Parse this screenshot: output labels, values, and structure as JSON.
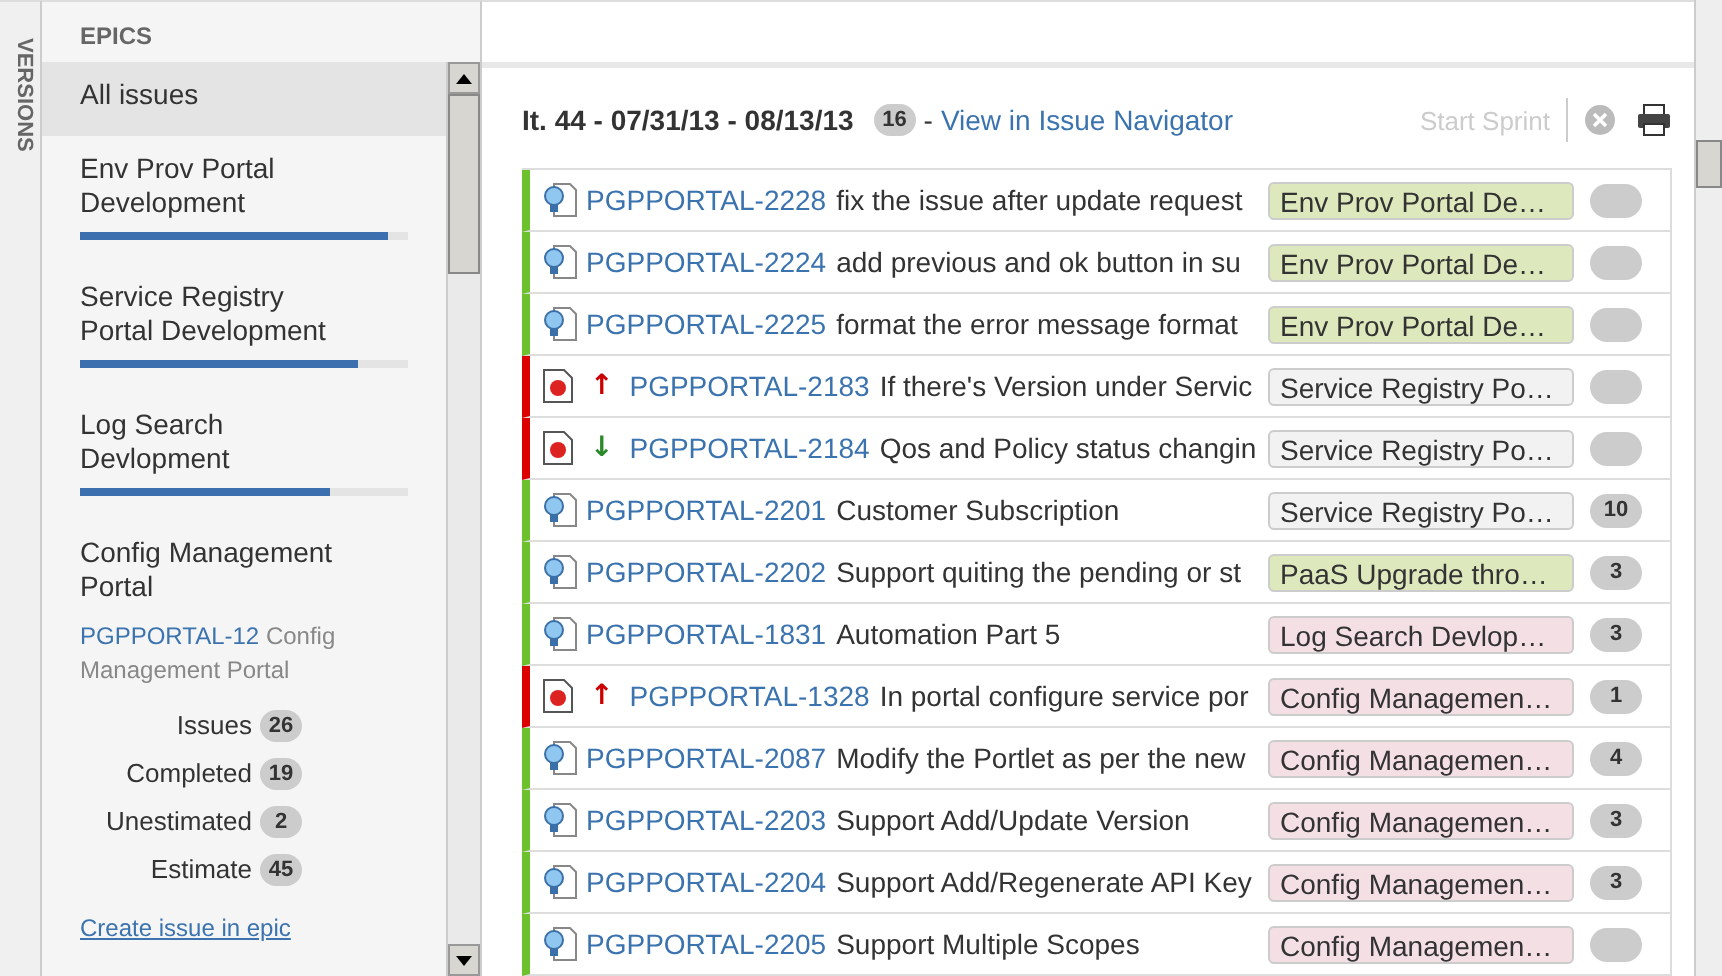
{
  "side_tab": {
    "label": "VERSIONS"
  },
  "epics": {
    "title": "EPICS",
    "items": [
      {
        "name": "All issues",
        "selected": true
      },
      {
        "name": "Env Prov Portal Development",
        "selected": false,
        "level": 0.94
      },
      {
        "name": "Service Registry Portal Development",
        "selected": false,
        "level": 0.85
      },
      {
        "name": "Log Search Devlopment",
        "selected": false,
        "level": 0.76
      },
      {
        "name": "Config Management Portal",
        "selected": false,
        "detail": {
          "key": "PGPPORTAL-12",
          "summary": "Config Management Portal",
          "stats": [
            {
              "label": "Issues",
              "count": "26"
            },
            {
              "label": "Completed",
              "count": "19"
            },
            {
              "label": "Unestimated",
              "count": "2"
            },
            {
              "label": "Estimate",
              "count": "45"
            }
          ],
          "create_link": "Create issue in epic"
        }
      }
    ]
  },
  "sprint": {
    "title": "It. 44 - 07/31/13 - 08/13/13",
    "count": "16",
    "separator": "-",
    "navigator_link": "View in Issue Navigator",
    "start_button": {
      "label": "Start Sprint",
      "disabled": true
    }
  },
  "issues": [
    {
      "kind": "improvement",
      "key": "PGPPORTAL-2228",
      "summary": "fix the issue after update request",
      "epic": "Env Prov Portal De…",
      "color": "#dde9bd"
    },
    {
      "kind": "improvement",
      "key": "PGPPORTAL-2224",
      "summary": "add previous and ok button in su",
      "epic": "Env Prov Portal De…",
      "color": "#dde9bd"
    },
    {
      "kind": "improvement",
      "key": "PGPPORTAL-2225",
      "summary": "format the error message format",
      "epic": "Env Prov Portal De…",
      "color": "#dde9bd"
    },
    {
      "kind": "bug",
      "priority": {
        "symbol": "↑",
        "color": "#cc0000"
      },
      "key": "PGPPORTAL-2183",
      "summary": "If there's Version under Servic",
      "epic": "Service Registry Po…",
      "color": "#f2f2f2"
    },
    {
      "kind": "bug",
      "priority": {
        "symbol": "↓",
        "color": "#2a8a2a"
      },
      "key": "PGPPORTAL-2184",
      "summary": "Qos and Policy status changin",
      "epic": "Service Registry Po…",
      "color": "#f2f2f2"
    },
    {
      "kind": "improvement",
      "key": "PGPPORTAL-2201",
      "summary": "Customer Subscription",
      "epic": "Service Registry Po…",
      "color": "#f2f2f2",
      "estimate": "10"
    },
    {
      "kind": "improvement",
      "key": "PGPPORTAL-2202",
      "summary": "Support quiting the pending or st",
      "epic": "PaaS Upgrade thro…",
      "color": "#dde9bd",
      "estimate": "3"
    },
    {
      "kind": "improvement",
      "key": "PGPPORTAL-1831",
      "summary": "Automation Part 5",
      "epic": "Log Search Devlop…",
      "color": "#f4dfe5",
      "estimate": "3"
    },
    {
      "kind": "bug",
      "priority": {
        "symbol": "↑",
        "color": "#cc0000"
      },
      "key": "PGPPORTAL-1328",
      "summary": "In portal configure service por",
      "epic": "Config Managemen…",
      "color": "#f4dfe5",
      "estimate": "1"
    },
    {
      "kind": "improvement",
      "key": "PGPPORTAL-2087",
      "summary": "Modify the Portlet as per the new",
      "epic": "Config Managemen…",
      "color": "#f4dfe5",
      "estimate": "4"
    },
    {
      "kind": "improvement",
      "key": "PGPPORTAL-2203",
      "summary": "Support Add/Update Version",
      "epic": "Config Managemen…",
      "color": "#f4dfe5",
      "estimate": "3"
    },
    {
      "kind": "improvement",
      "key": "PGPPORTAL-2204",
      "summary": "Support Add/Regenerate API Key",
      "epic": "Config Managemen…",
      "color": "#f4dfe5",
      "estimate": "3"
    },
    {
      "kind": "improvement",
      "key": "PGPPORTAL-2205",
      "summary": "Support Multiple Scopes",
      "epic": "Config Managemen…",
      "color": "#f4dfe5"
    }
  ]
}
